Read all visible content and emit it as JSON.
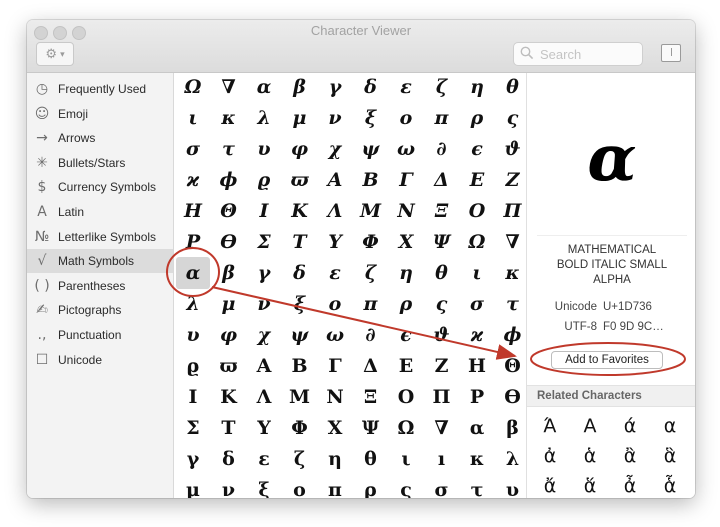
{
  "window": {
    "title": "Character Viewer"
  },
  "toolbar": {
    "search_placeholder": "Search"
  },
  "sidebar": {
    "items": [
      {
        "label": "Frequently Used",
        "icon": "clock-icon",
        "glyph": "◷"
      },
      {
        "label": "Emoji",
        "icon": "smiley-icon",
        "glyph": "☺"
      },
      {
        "label": "Arrows",
        "icon": "arrow-icon",
        "glyph": "→"
      },
      {
        "label": "Bullets/Stars",
        "icon": "star-icon",
        "glyph": "✳"
      },
      {
        "label": "Currency Symbols",
        "icon": "dollar-icon",
        "glyph": "$"
      },
      {
        "label": "Latin",
        "icon": "latin-a-icon",
        "glyph": "A"
      },
      {
        "label": "Letterlike Symbols",
        "icon": "numero-icon",
        "glyph": "№"
      },
      {
        "label": "Math Symbols",
        "icon": "square-root-icon",
        "glyph": "√"
      },
      {
        "label": "Parentheses",
        "icon": "parentheses-icon",
        "glyph": "( )"
      },
      {
        "label": "Pictographs",
        "icon": "pictograph-icon",
        "glyph": "✍"
      },
      {
        "label": "Punctuation",
        "icon": "punctuation-icon",
        "glyph": ".,"
      },
      {
        "label": "Unicode",
        "icon": "unicode-box-icon",
        "glyph": "☐"
      }
    ],
    "selected": "Math Symbols"
  },
  "grid": {
    "rows": [
      [
        "Ω",
        "∇",
        "α",
        "β",
        "γ",
        "δ",
        "ε",
        "ζ",
        "η",
        "θ"
      ],
      [
        "ι",
        "κ",
        "λ",
        "μ",
        "ν",
        "ξ",
        "ο",
        "π",
        "ρ",
        "ς"
      ],
      [
        "σ",
        "τ",
        "υ",
        "φ",
        "χ",
        "ψ",
        "ω",
        "∂",
        "ϵ",
        "ϑ"
      ],
      [
        "ϰ",
        "ϕ",
        "ϱ",
        "ϖ",
        "Α",
        "Β",
        "Γ",
        "Δ",
        "Ε",
        "Ζ"
      ],
      [
        "Η",
        "Θ",
        "Ι",
        "Κ",
        "Λ",
        "Μ",
        "Ν",
        "Ξ",
        "Ο",
        "Π"
      ],
      [
        "Ρ",
        "ϴ",
        "Σ",
        "Τ",
        "Υ",
        "Φ",
        "Χ",
        "Ψ",
        "Ω",
        "∇"
      ],
      [
        "α",
        "β",
        "γ",
        "δ",
        "ε",
        "ζ",
        "η",
        "θ",
        "ι",
        "κ"
      ],
      [
        "λ",
        "μ",
        "ν",
        "ξ",
        "ο",
        "π",
        "ρ",
        "ς",
        "σ",
        "τ"
      ],
      [
        "υ",
        "φ",
        "χ",
        "ψ",
        "ω",
        "∂",
        "ϵ",
        "ϑ",
        "ϰ",
        "ϕ"
      ],
      [
        "ϱ",
        "ϖ",
        "Α",
        "Β",
        "Γ",
        "Δ",
        "Ε",
        "Ζ",
        "Η",
        "Θ"
      ],
      [
        "Ι",
        "Κ",
        "Λ",
        "Μ",
        "Ν",
        "Ξ",
        "Ο",
        "Π",
        "Ρ",
        "ϴ"
      ],
      [
        "Σ",
        "Τ",
        "Υ",
        "Φ",
        "Χ",
        "Ψ",
        "Ω",
        "∇",
        "α",
        "β"
      ],
      [
        "γ",
        "δ",
        "ε",
        "ζ",
        "η",
        "θ",
        "ι",
        "ı",
        "κ",
        "λ"
      ],
      [
        "μ",
        "ν",
        "ξ",
        "ο",
        "π",
        "ρ",
        "ς",
        "σ",
        "τ",
        "υ"
      ]
    ],
    "selected": {
      "row": 6,
      "col": 0
    }
  },
  "detail": {
    "glyph": "α",
    "name_lines": [
      "MATHEMATICAL",
      "BOLD ITALIC SMALL",
      "ALPHA"
    ],
    "unicode_label": "Unicode",
    "unicode_value": "U+1D736",
    "utf8_label": "UTF-8",
    "utf8_value": "F0 9D 9C…",
    "add_favorites_label": "Add to Favorites",
    "related_heading": "Related Characters",
    "related": [
      "Ά",
      "Α",
      "ά",
      "α",
      "ἀ",
      "ἁ",
      "ἂ",
      "ἃ",
      "ἄ",
      "ἅ",
      "ἆ",
      "ἇ"
    ]
  },
  "annotation": {
    "color": "#c0392b"
  }
}
